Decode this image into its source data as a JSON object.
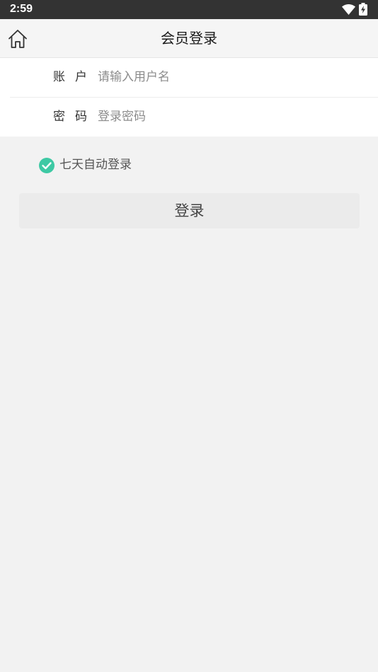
{
  "status_bar": {
    "time": "2:59",
    "icons": [
      "wifi-icon",
      "battery-charging-icon"
    ]
  },
  "header": {
    "home_icon": "home-icon",
    "title": "会员登录"
  },
  "form": {
    "account": {
      "label_chars": [
        "账",
        "户"
      ],
      "placeholder": "请输入用户名",
      "value": ""
    },
    "password": {
      "label_chars": [
        "密",
        "码"
      ],
      "placeholder": "登录密码",
      "value": ""
    }
  },
  "remember": {
    "label": "七天自动登录",
    "checked": true,
    "check_color": "#3ec9a4"
  },
  "login_button": {
    "label": "登录"
  },
  "colors": {
    "status_bar": "#333333",
    "header_bg": "#f5f5f5",
    "page_bg": "#f2f2f2",
    "button_bg": "#ebebeb"
  }
}
